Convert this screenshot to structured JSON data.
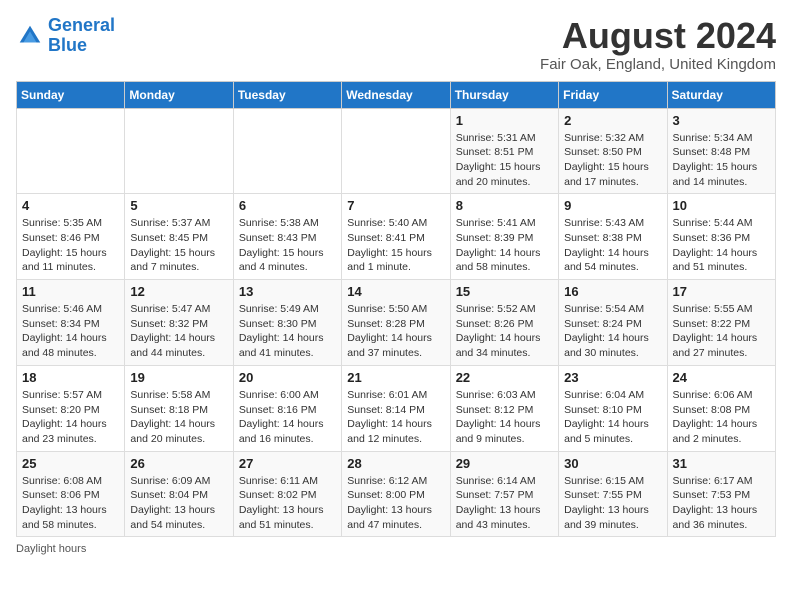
{
  "header": {
    "logo_line1": "General",
    "logo_line2": "Blue",
    "month_year": "August 2024",
    "location": "Fair Oak, England, United Kingdom"
  },
  "days_of_week": [
    "Sunday",
    "Monday",
    "Tuesday",
    "Wednesday",
    "Thursday",
    "Friday",
    "Saturday"
  ],
  "weeks": [
    [
      {
        "day": "",
        "info": ""
      },
      {
        "day": "",
        "info": ""
      },
      {
        "day": "",
        "info": ""
      },
      {
        "day": "",
        "info": ""
      },
      {
        "day": "1",
        "info": "Sunrise: 5:31 AM\nSunset: 8:51 PM\nDaylight: 15 hours\nand 20 minutes."
      },
      {
        "day": "2",
        "info": "Sunrise: 5:32 AM\nSunset: 8:50 PM\nDaylight: 15 hours\nand 17 minutes."
      },
      {
        "day": "3",
        "info": "Sunrise: 5:34 AM\nSunset: 8:48 PM\nDaylight: 15 hours\nand 14 minutes."
      }
    ],
    [
      {
        "day": "4",
        "info": "Sunrise: 5:35 AM\nSunset: 8:46 PM\nDaylight: 15 hours\nand 11 minutes."
      },
      {
        "day": "5",
        "info": "Sunrise: 5:37 AM\nSunset: 8:45 PM\nDaylight: 15 hours\nand 7 minutes."
      },
      {
        "day": "6",
        "info": "Sunrise: 5:38 AM\nSunset: 8:43 PM\nDaylight: 15 hours\nand 4 minutes."
      },
      {
        "day": "7",
        "info": "Sunrise: 5:40 AM\nSunset: 8:41 PM\nDaylight: 15 hours\nand 1 minute."
      },
      {
        "day": "8",
        "info": "Sunrise: 5:41 AM\nSunset: 8:39 PM\nDaylight: 14 hours\nand 58 minutes."
      },
      {
        "day": "9",
        "info": "Sunrise: 5:43 AM\nSunset: 8:38 PM\nDaylight: 14 hours\nand 54 minutes."
      },
      {
        "day": "10",
        "info": "Sunrise: 5:44 AM\nSunset: 8:36 PM\nDaylight: 14 hours\nand 51 minutes."
      }
    ],
    [
      {
        "day": "11",
        "info": "Sunrise: 5:46 AM\nSunset: 8:34 PM\nDaylight: 14 hours\nand 48 minutes."
      },
      {
        "day": "12",
        "info": "Sunrise: 5:47 AM\nSunset: 8:32 PM\nDaylight: 14 hours\nand 44 minutes."
      },
      {
        "day": "13",
        "info": "Sunrise: 5:49 AM\nSunset: 8:30 PM\nDaylight: 14 hours\nand 41 minutes."
      },
      {
        "day": "14",
        "info": "Sunrise: 5:50 AM\nSunset: 8:28 PM\nDaylight: 14 hours\nand 37 minutes."
      },
      {
        "day": "15",
        "info": "Sunrise: 5:52 AM\nSunset: 8:26 PM\nDaylight: 14 hours\nand 34 minutes."
      },
      {
        "day": "16",
        "info": "Sunrise: 5:54 AM\nSunset: 8:24 PM\nDaylight: 14 hours\nand 30 minutes."
      },
      {
        "day": "17",
        "info": "Sunrise: 5:55 AM\nSunset: 8:22 PM\nDaylight: 14 hours\nand 27 minutes."
      }
    ],
    [
      {
        "day": "18",
        "info": "Sunrise: 5:57 AM\nSunset: 8:20 PM\nDaylight: 14 hours\nand 23 minutes."
      },
      {
        "day": "19",
        "info": "Sunrise: 5:58 AM\nSunset: 8:18 PM\nDaylight: 14 hours\nand 20 minutes."
      },
      {
        "day": "20",
        "info": "Sunrise: 6:00 AM\nSunset: 8:16 PM\nDaylight: 14 hours\nand 16 minutes."
      },
      {
        "day": "21",
        "info": "Sunrise: 6:01 AM\nSunset: 8:14 PM\nDaylight: 14 hours\nand 12 minutes."
      },
      {
        "day": "22",
        "info": "Sunrise: 6:03 AM\nSunset: 8:12 PM\nDaylight: 14 hours\nand 9 minutes."
      },
      {
        "day": "23",
        "info": "Sunrise: 6:04 AM\nSunset: 8:10 PM\nDaylight: 14 hours\nand 5 minutes."
      },
      {
        "day": "24",
        "info": "Sunrise: 6:06 AM\nSunset: 8:08 PM\nDaylight: 14 hours\nand 2 minutes."
      }
    ],
    [
      {
        "day": "25",
        "info": "Sunrise: 6:08 AM\nSunset: 8:06 PM\nDaylight: 13 hours\nand 58 minutes."
      },
      {
        "day": "26",
        "info": "Sunrise: 6:09 AM\nSunset: 8:04 PM\nDaylight: 13 hours\nand 54 minutes."
      },
      {
        "day": "27",
        "info": "Sunrise: 6:11 AM\nSunset: 8:02 PM\nDaylight: 13 hours\nand 51 minutes."
      },
      {
        "day": "28",
        "info": "Sunrise: 6:12 AM\nSunset: 8:00 PM\nDaylight: 13 hours\nand 47 minutes."
      },
      {
        "day": "29",
        "info": "Sunrise: 6:14 AM\nSunset: 7:57 PM\nDaylight: 13 hours\nand 43 minutes."
      },
      {
        "day": "30",
        "info": "Sunrise: 6:15 AM\nSunset: 7:55 PM\nDaylight: 13 hours\nand 39 minutes."
      },
      {
        "day": "31",
        "info": "Sunrise: 6:17 AM\nSunset: 7:53 PM\nDaylight: 13 hours\nand 36 minutes."
      }
    ]
  ],
  "footer": {
    "note": "Daylight hours"
  }
}
